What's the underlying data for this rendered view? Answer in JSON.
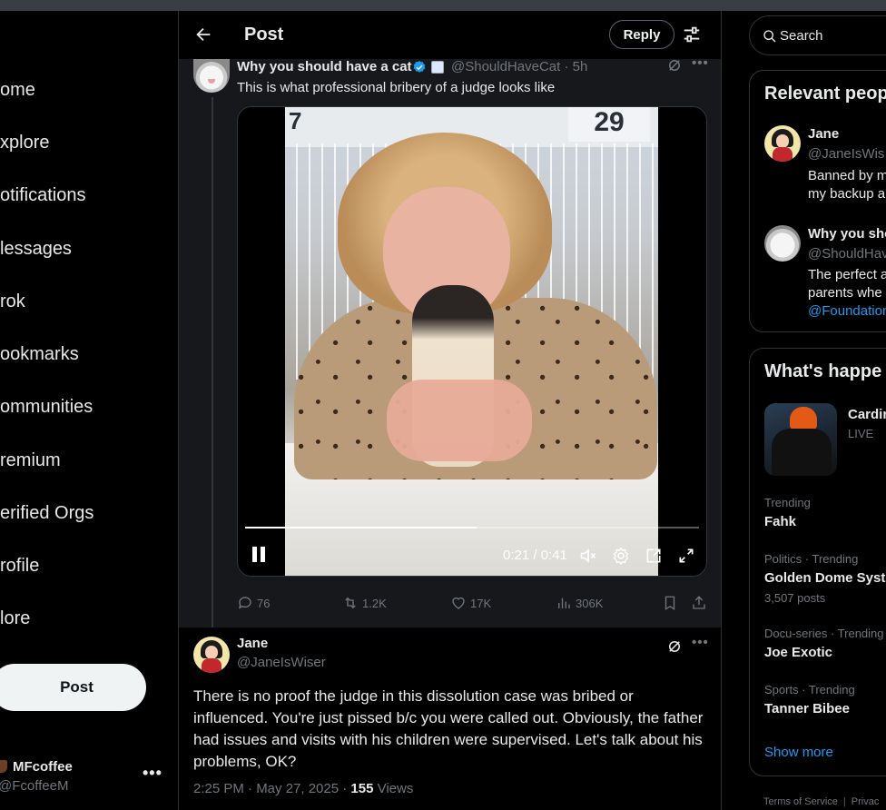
{
  "nav": {
    "items": [
      "ome",
      "xplore",
      "otifications",
      "lessages",
      "rok",
      "ookmarks",
      "ommunities",
      "remium",
      "erified Orgs",
      "rofile",
      "lore"
    ],
    "post_label": "Post",
    "account": {
      "name": "MFcoffee",
      "handle": "@FcoffeeM",
      "more": "•••"
    }
  },
  "header": {
    "title": "Post",
    "reply_label": "Reply"
  },
  "tweet": {
    "name": "Why you should have a cat",
    "handle_time": "@ShouldHaveCat · 5h",
    "text": "This is what professional bribery of a judge looks like",
    "video": {
      "sign_text": "29",
      "sign_left": "7",
      "time": "0:21 / 0:41",
      "progress": 0.51
    },
    "stats": {
      "replies": "76",
      "reposts": "1.2K",
      "likes": "17K",
      "views": "306K"
    }
  },
  "reply": {
    "name": "Jane",
    "handle": "@JaneIsWiser",
    "text": "There is no proof the judge in this dissolution case was bribed or influenced. You're just pissed b/c you were called out. Obviously, the father had issues and visits with his children were supervised. Let's talk about his problems, OK?",
    "time": "2:25 PM · May 27, 2025 · ",
    "views_count": "155",
    "views_label": " Views"
  },
  "sidebar": {
    "search_placeholder": "Search",
    "relevant": {
      "title": "Relevant peop",
      "people": [
        {
          "name": "Jane",
          "handle": "@JaneIsWis",
          "bio1": "Banned by m",
          "bio2": "my backup a"
        },
        {
          "name": "Why you sho",
          "handle": "@ShouldHav",
          "bio1": "The perfect a",
          "bio2": "parents whe",
          "bio3": "@Foundation"
        }
      ]
    },
    "happening": {
      "title": "What's happe",
      "news_title": "Cardin",
      "news_status": "LIVE",
      "trends": [
        {
          "meta": "Trending",
          "name": "Fahk",
          "count": ""
        },
        {
          "meta": "Politics · Trending",
          "name": "Golden Dome Syst",
          "count": "3,507 posts"
        },
        {
          "meta": "Docu-series · Trending",
          "name": "Joe Exotic",
          "count": ""
        },
        {
          "meta": "Sports · Trending",
          "name": "Tanner Bibee",
          "count": ""
        }
      ],
      "show_more": "Show more"
    },
    "footer": {
      "terms": "Terms of Service",
      "sep": "|",
      "privacy": "Privac"
    }
  },
  "colors": {
    "accent": "#1d9bf0",
    "background": "#000000",
    "text": "#e7e9ea",
    "muted": "#71767b"
  }
}
